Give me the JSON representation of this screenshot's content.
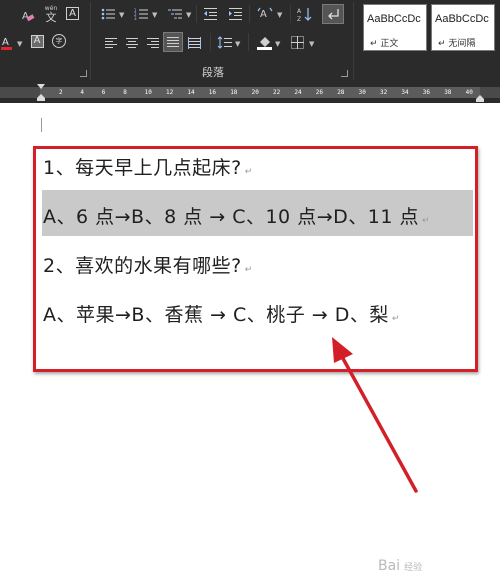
{
  "ribbon": {
    "group_label": "段落",
    "styles": [
      {
        "preview": "AaBbCcDc",
        "name": "↵ 正文"
      },
      {
        "preview": "AaBbCcDc",
        "name": "↵ 无间隔"
      }
    ],
    "icons": {
      "phonetic_guide": "wén",
      "phonetic_char": "文",
      "char_border": "A",
      "char_shading": "A",
      "enclose_char": "字"
    }
  },
  "ruler": {
    "ticks": [
      "2",
      "4",
      "6",
      "8",
      "10",
      "12",
      "14",
      "16",
      "18",
      "20",
      "22",
      "24",
      "26",
      "28",
      "30",
      "32",
      "34",
      "36",
      "38",
      "40"
    ]
  },
  "document": {
    "paragraphs": [
      {
        "text": "1、每天早上几点起床?",
        "mark": "↵"
      },
      {
        "text": "A、6 点→B、8 点 → C、10 点→D、11 点",
        "mark": "↵"
      },
      {
        "text": "2、喜欢的水果有哪些?",
        "mark": "↵"
      },
      {
        "text": "A、苹果→B、香蕉 → C、桃子 → D、梨",
        "mark": "↵"
      }
    ]
  },
  "watermark": {
    "text": "Bai",
    "sub": "经验"
  },
  "colors": {
    "annotation_red": "#d32028",
    "highlight_gray": "#c9c9c9",
    "ribbon_bg": "#2b2b2b"
  }
}
